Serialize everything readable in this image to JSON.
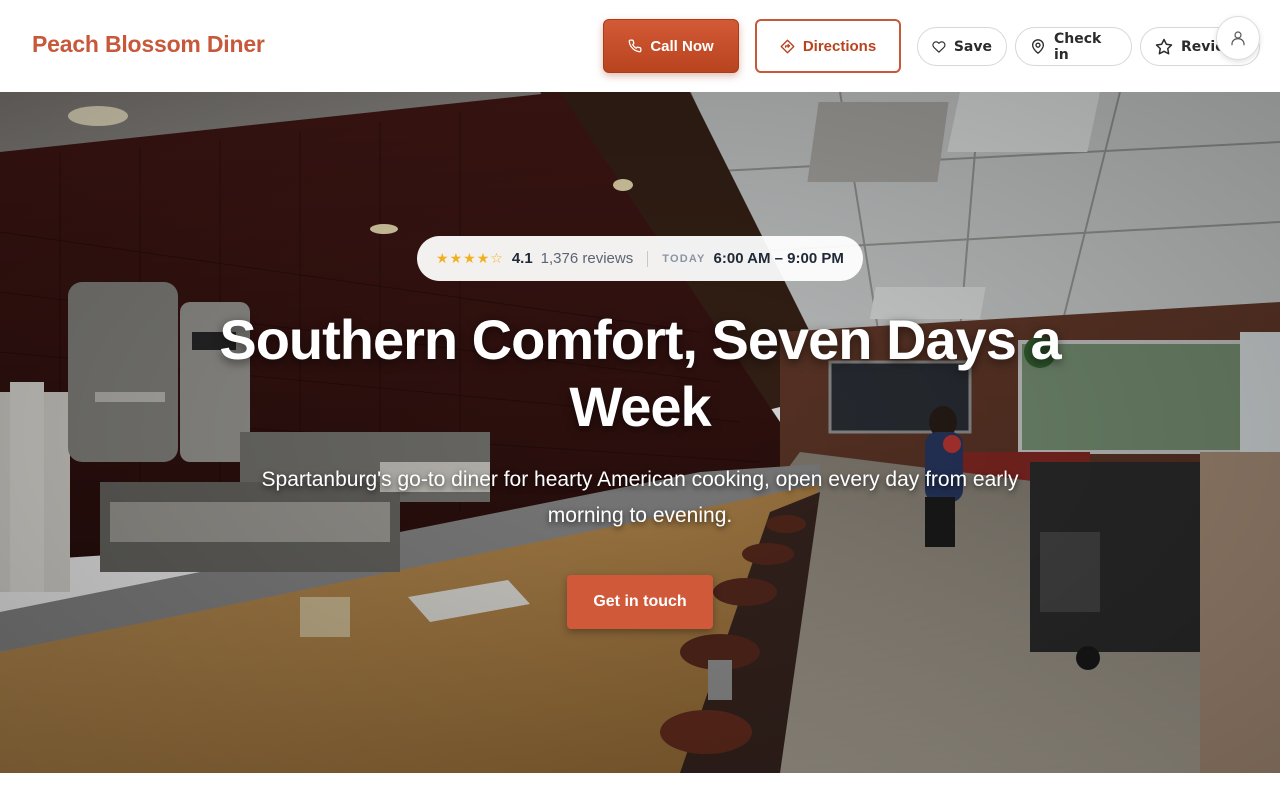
{
  "header": {
    "brand": "Peach Blossom Diner",
    "call_label": "Call Now",
    "directions_label": "Directions",
    "save_label": "Save",
    "checkin_label": "Check in",
    "review_label": "Review"
  },
  "hero": {
    "stars": [
      "★",
      "★",
      "★",
      "★",
      "☆"
    ],
    "rating": "4.1",
    "reviews": "1,376 reviews",
    "today_label": "TODAY",
    "hours": "6:00 AM – 9:00 PM",
    "headline": "Southern Comfort, Seven Days a Week",
    "subtitle": "Spartanburg's go-to diner for hearty American cooking, open every day from early morning to evening.",
    "cta_label": "Get in touch"
  },
  "icons": {
    "phone": "phone-icon",
    "directions": "directions-icon",
    "save": "heart-icon",
    "checkin": "map-pin-icon",
    "review": "star-icon",
    "account": "user-icon"
  },
  "colors": {
    "brand": "#c8583a",
    "cta": "#d0593a",
    "star": "#f2b01e"
  }
}
